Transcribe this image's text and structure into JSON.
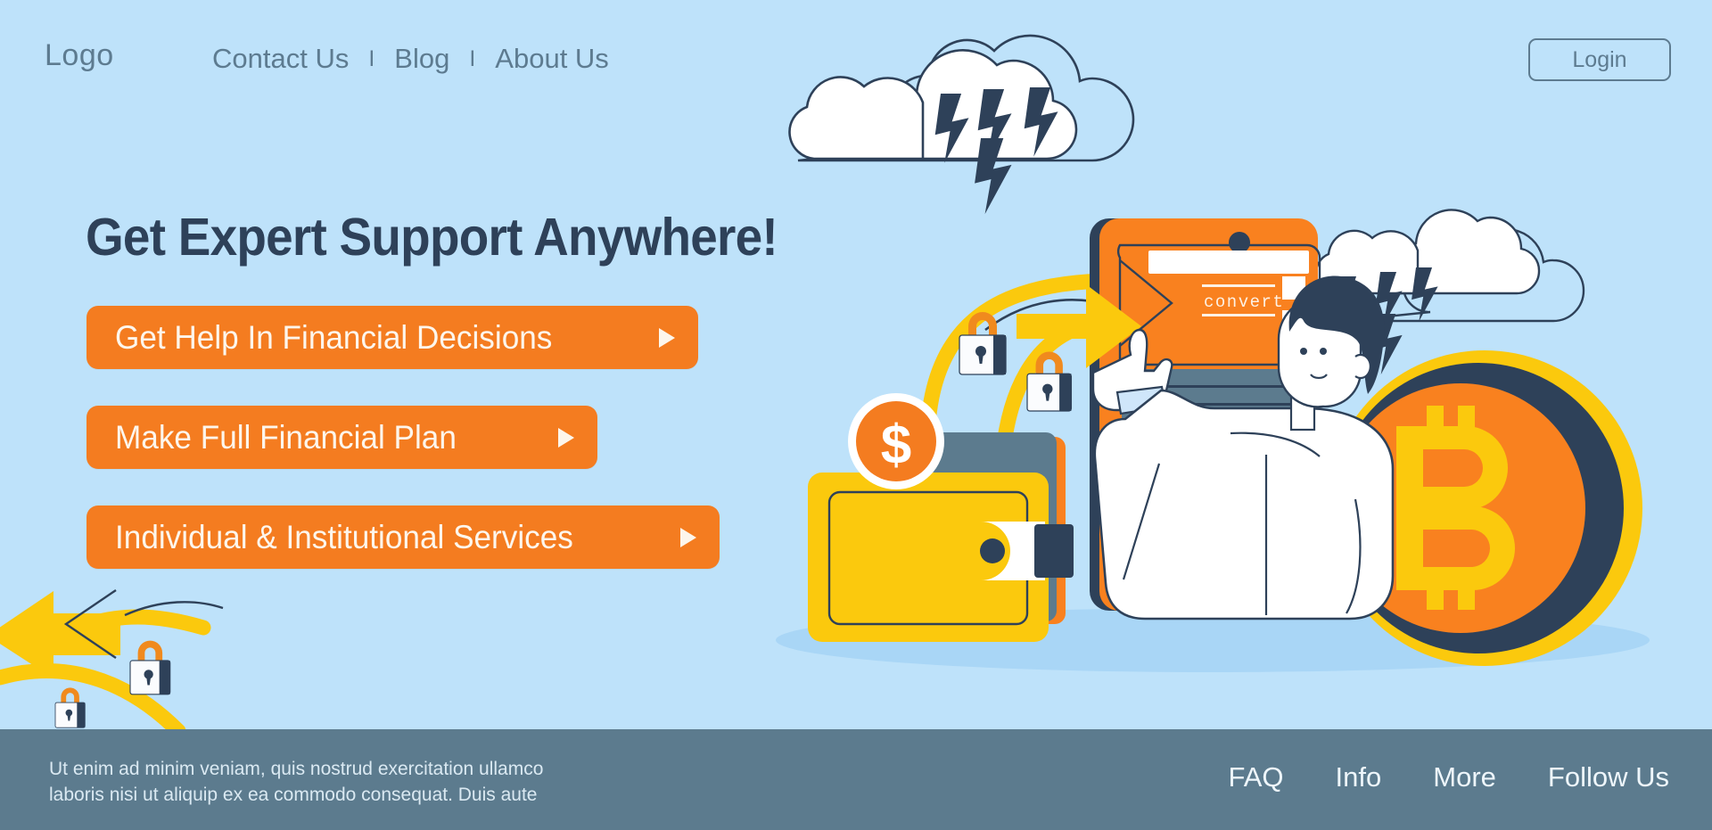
{
  "page": {
    "background_color": "#bee2fa",
    "accent_orange": "#f47c20",
    "accent_yellow": "#fbc90d",
    "navy": "#2e4159",
    "slate": "#5c7b8e"
  },
  "header": {
    "logo": "Logo",
    "nav": [
      {
        "label": "Contact Us"
      },
      {
        "label": "Blog"
      },
      {
        "label": "About Us"
      }
    ],
    "separator": "I",
    "login_label": "Login"
  },
  "hero": {
    "headline": "Get Expert Support Anywhere!",
    "ctas": [
      {
        "label": "Get Help In Financial Decisions",
        "arrow": "play-arrow"
      },
      {
        "label": "Make Full Financial Plan",
        "arrow": "play-arrow"
      },
      {
        "label": "Individual & Institutional Services",
        "arrow": "play-arrow"
      }
    ]
  },
  "illustration": {
    "screen_text": "convert",
    "coin_symbol": "$",
    "bitcoin_symbol": "B",
    "elements": [
      "rain-cloud-top",
      "rain-cloud-right",
      "tablet-device",
      "wallet",
      "dollar-coin",
      "bitcoin-coin",
      "person-pointing",
      "padlock",
      "yellow-arrow"
    ]
  },
  "footer": {
    "text_line1": "Ut enim ad minim veniam, quis nostrud exercitation ullamco",
    "text_line2": "laboris nisi ut aliquip ex ea commodo consequat. Duis aute",
    "links": [
      {
        "label": "FAQ"
      },
      {
        "label": "Info"
      },
      {
        "label": "More"
      },
      {
        "label": "Follow Us"
      }
    ]
  }
}
